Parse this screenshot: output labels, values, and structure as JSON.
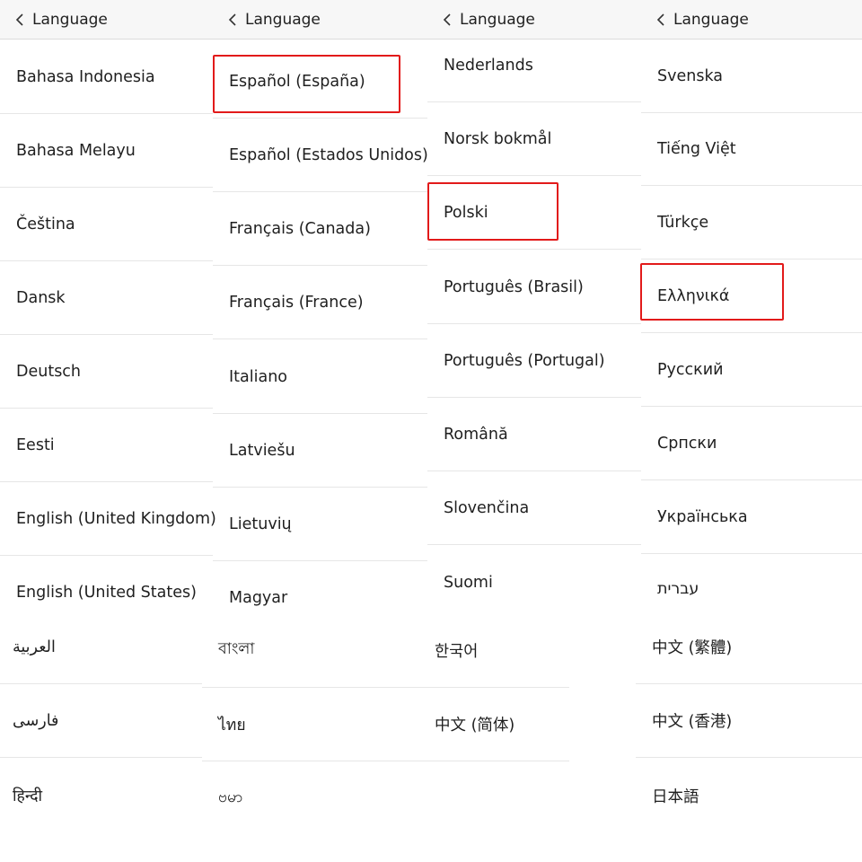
{
  "header": {
    "title": "Language"
  },
  "accent_color": "#e21a1a",
  "panels": [
    {
      "items": [
        "Bahasa Indonesia",
        "Bahasa Melayu",
        "Čeština",
        "Dansk",
        "Deutsch",
        "Eesti",
        "English (United Kingdom)",
        "English (United States)"
      ],
      "bottom_items": [
        "العربية",
        "فارسی",
        "हिन्दी"
      ]
    },
    {
      "items": [
        "Español (España)",
        "Español (Estados Unidos)",
        "Français (Canada)",
        "Français (France)",
        "Italiano",
        "Latviešu",
        "Lietuvių",
        "Magyar"
      ],
      "selected": "Español (España)",
      "bottom_items": [
        "বাংলা",
        "ไทย",
        "ဗမာ"
      ]
    },
    {
      "items": [
        "Nederlands",
        "Norsk bokmål",
        "Polski",
        "Português (Brasil)",
        "Português (Portugal)",
        "Română",
        "Slovenčina",
        "Suomi"
      ],
      "selected": "Polski",
      "bottom_items": [
        "한국어",
        "中文 (简体)"
      ]
    },
    {
      "items": [
        "Svenska",
        "Tiếng Việt",
        "Türkçe",
        "Ελληνικά",
        "Русский",
        "Српски",
        "Українська",
        "עברית"
      ],
      "selected": "Ελληνικά",
      "bottom_items": [
        "中文 (繁體)",
        "中文 (香港)",
        "日本語"
      ]
    }
  ]
}
